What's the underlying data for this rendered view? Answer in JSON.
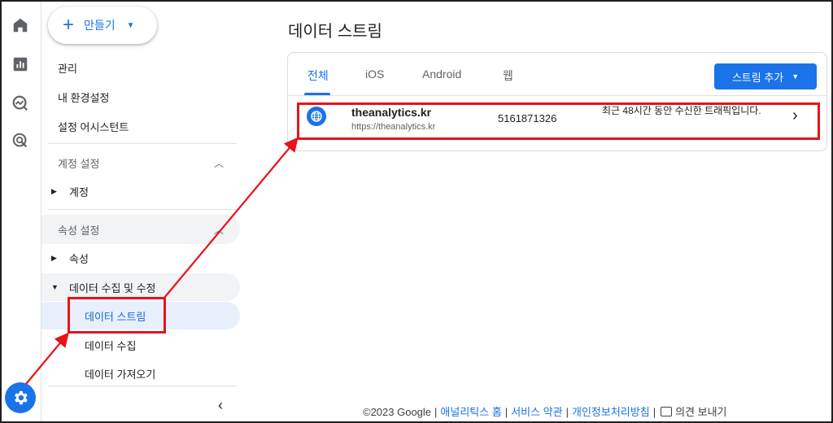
{
  "rail": {
    "icons": [
      "home-icon",
      "reports-icon",
      "explore-icon",
      "advertising-icon",
      "admin-gear-icon"
    ]
  },
  "nav": {
    "create_label": "만들기",
    "links": [
      "관리",
      "내 환경설정",
      "설정 어시스턴트"
    ],
    "account_section": "계정 설정",
    "account_item": "계정",
    "property_section": "속성 설정",
    "property_item": "속성",
    "data_collection_group": "데이터 수집 및 수정",
    "sub_items": [
      "데이터 스트림",
      "데이터 수집",
      "데이터 가져오기"
    ]
  },
  "main": {
    "title": "데이터 스트림",
    "tabs": [
      "전체",
      "iOS",
      "Android",
      "웹"
    ],
    "active_tab": "전체",
    "add_stream_label": "스트림 추가",
    "stream": {
      "name": "theanalytics.kr",
      "url": "https://theanalytics.kr",
      "id": "5161871326",
      "status": "최근 48시간 동안 수신한 트래픽입니다."
    }
  },
  "footer": {
    "copyright": "©2023 Google",
    "links": [
      "애널리틱스 홈",
      "서비스 약관",
      "개인정보처리방침"
    ],
    "feedback": "의견 보내기"
  },
  "colors": {
    "accent": "#1a73e8",
    "highlight": "#e8131b"
  }
}
